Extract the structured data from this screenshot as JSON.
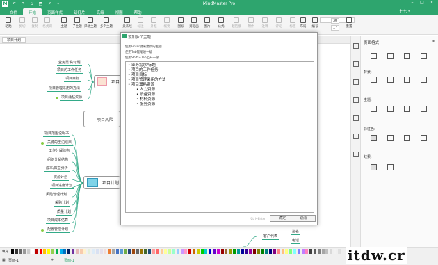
{
  "titlebar": {
    "app_title": "MindMaster Pro",
    "logo": "M",
    "quick_access": "↶ ↷ ⌂ ⬒ ↗ ▾"
  },
  "menu": {
    "tabs": [
      "文件",
      "开始",
      "页面样式",
      "幻灯片",
      "高级",
      "视图",
      "帮助"
    ],
    "active": "开始",
    "user": "七七 ▾"
  },
  "ribbon": {
    "buttons": [
      "粘贴",
      "剪切",
      "复制",
      "格式刷",
      "主题",
      "子主题",
      "浮动主题",
      "多个主题",
      "关系线",
      "标注",
      "外框",
      "概要",
      "图标",
      "剪贴画",
      "图片",
      "公式",
      "超链接",
      "附件",
      "注释",
      "评论",
      "标签",
      "布局",
      "编号",
      "重置"
    ],
    "font_size": "30",
    "font_size2": "17"
  },
  "doc_tab": "项目计划",
  "mindmap": {
    "top_nodes": [
      "业务需求/标题",
      "项目的工作任务",
      "项目目标",
      "项目管理采用的方法",
      "项目涌粘资源"
    ],
    "central1": "项目目",
    "risk": "项目风险",
    "plan_nodes": [
      "项目范围说明书",
      "关键的里边结果",
      "工作分解结构",
      "组织分解结构",
      "成本/效益分析",
      "资源计划",
      "项目进度计划",
      "风险管理计划",
      "采购计划",
      "质量计划",
      "项目成本估算",
      "配置管理计划"
    ],
    "central2": "项目计划",
    "bottom_nodes": [
      "签名",
      "客户代表",
      "电话"
    ]
  },
  "dialog": {
    "title": "添加多个主题",
    "hints": [
      "使用Enter键来建新的主题",
      "使用Tab键缩进一级",
      "使用Shift+Tab上升一级"
    ],
    "items": [
      "业务需求/标题",
      "项目的工作任务",
      "项目目标",
      "项目管理采用的方法",
      "项目涌粘资源"
    ],
    "sub_items": [
      "人力资源",
      "设备资源",
      "材料资源",
      "服务资源"
    ],
    "shortcut": "(Ctrl+Enter)",
    "ok": "确定",
    "cancel": "取消"
  },
  "rightpanel": {
    "title": "页面格式",
    "close": "×",
    "labels": [
      "背景:",
      "主题:",
      "彩虹色:",
      "效果:"
    ],
    "strip_icons": [
      "page-format-icon",
      "style-icon",
      "theme-icon",
      "outline-icon",
      "history-icon",
      "clipart-icon",
      "task-icon"
    ]
  },
  "colorbar": {
    "label": "填充",
    "colors": [
      "#000000",
      "#333333",
      "#666666",
      "#999999",
      "#cccccc",
      "#ffffff",
      "#c00000",
      "#ff0000",
      "#ffc000",
      "#ffff00",
      "#92d050",
      "#00b050",
      "#00b0f0",
      "#0070c0",
      "#002060",
      "#7030a0",
      "#e6b8b7",
      "#f8cbad",
      "#fff2cc",
      "#e2efda",
      "#ddebf7",
      "#d9e1f2",
      "#e4dfec",
      "#f2dcdb",
      "#ed7d31",
      "#a5a5a5",
      "#4472c4",
      "#5b9bd5",
      "#70ad47",
      "#264478",
      "#9e480e",
      "#636363",
      "#997300",
      "#43682b",
      "#1f4e79",
      "#ff9999",
      "#ff6666",
      "#ffcc99",
      "#ffff99",
      "#ccff99",
      "#99ffcc",
      "#99ccff",
      "#cc99ff",
      "#ff99cc",
      "#cc0000",
      "#cc6600",
      "#cccc00",
      "#00cc00",
      "#00cccc",
      "#0000cc",
      "#6600cc",
      "#cc00cc",
      "#990000",
      "#996633",
      "#999900",
      "#009900",
      "#009999",
      "#000099",
      "#330099",
      "#990099",
      "#800000",
      "#808000",
      "#008000",
      "#008080",
      "#000080",
      "#800080",
      "#ff8080",
      "#ffbf80",
      "#ffff80",
      "#80ff80",
      "#80ffff",
      "#8080ff",
      "#bf80ff",
      "#ff80bf",
      "#404040",
      "#595959",
      "#7f7f7f",
      "#a6a6a6",
      "#bfbfbf",
      "#d9d9d9",
      "#f2f2f2",
      "#e0e0e0"
    ]
  },
  "statusbar": {
    "page1": "页面-1",
    "page_tab": "页面-1",
    "plus": "+"
  },
  "watermark": "itdw.cr"
}
